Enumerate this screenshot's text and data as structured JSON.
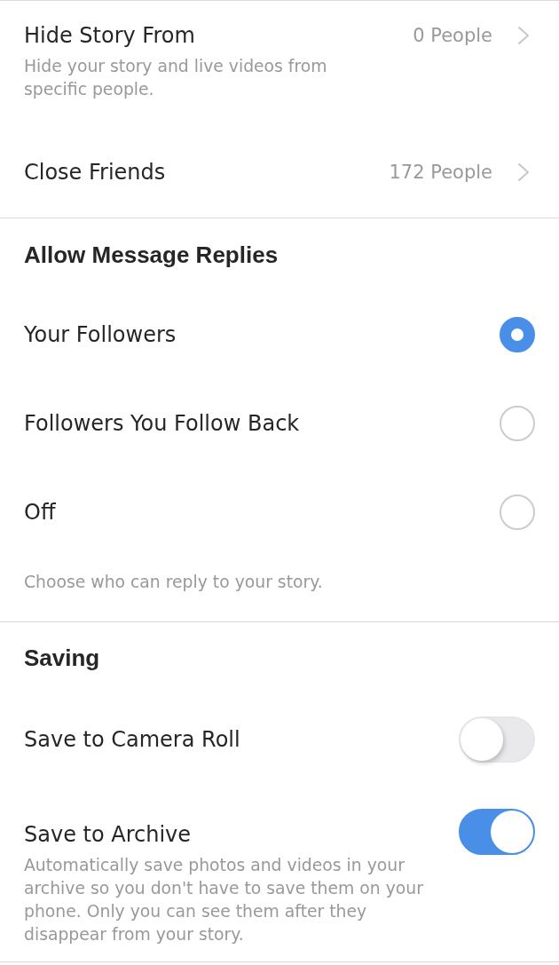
{
  "audience": {
    "rows": [
      {
        "label": "Hide Story From",
        "description": "Hide your story and live videos from specific people.",
        "value": "0 People"
      },
      {
        "label": "Close Friends",
        "value": "172 People"
      }
    ]
  },
  "message_replies": {
    "title": "Allow Message Replies",
    "options": [
      {
        "label": "Your Followers",
        "selected": true
      },
      {
        "label": "Followers You Follow Back",
        "selected": false
      },
      {
        "label": "Off",
        "selected": false
      }
    ],
    "footer": "Choose who can reply to your story."
  },
  "saving": {
    "title": "Saving",
    "toggles": [
      {
        "label": "Save to Camera Roll",
        "on": false
      },
      {
        "label": "Save to Archive",
        "on": true,
        "description": "Automatically save photos and videos in your archive so you don't have to save them on your phone. Only you can see them after they disappear from your story."
      }
    ]
  }
}
